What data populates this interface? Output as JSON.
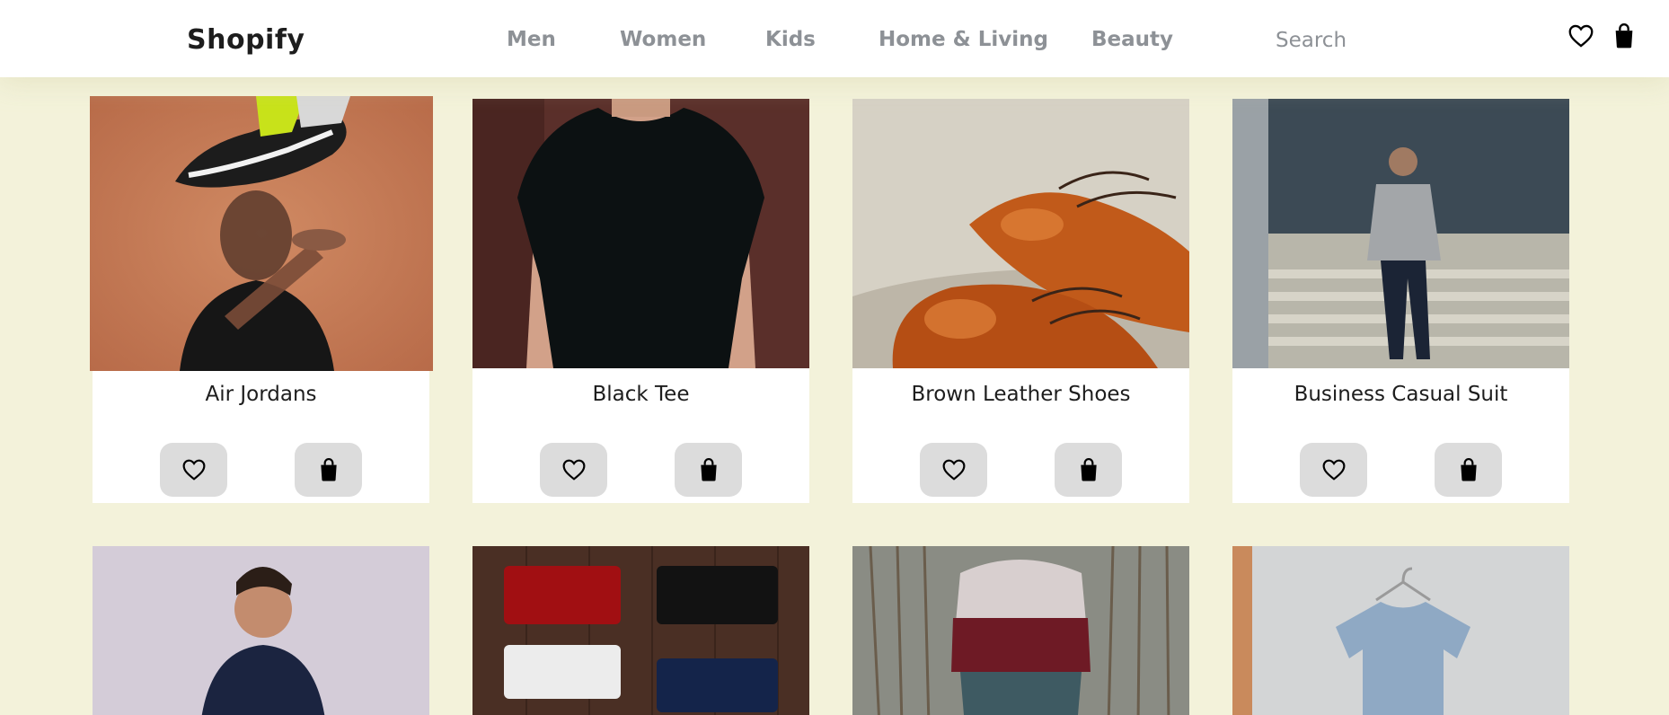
{
  "brand": "Shopify",
  "nav": {
    "links": [
      "Men",
      "Women",
      "Kids",
      "Home & Living",
      "Beauty"
    ],
    "search_placeholder": "Search"
  },
  "icons": {
    "wishlist": "heart-icon",
    "cart": "shopping-bag-icon"
  },
  "colors": {
    "page_background": "#f3f2da",
    "nav_background": "#ffffff",
    "nav_link": "#8d9196",
    "button_background": "#dcdcdc"
  },
  "products": [
    {
      "name": "Air Jordans"
    },
    {
      "name": "Black Tee"
    },
    {
      "name": "Brown Leather Shoes"
    },
    {
      "name": "Business Casual Suit"
    }
  ]
}
